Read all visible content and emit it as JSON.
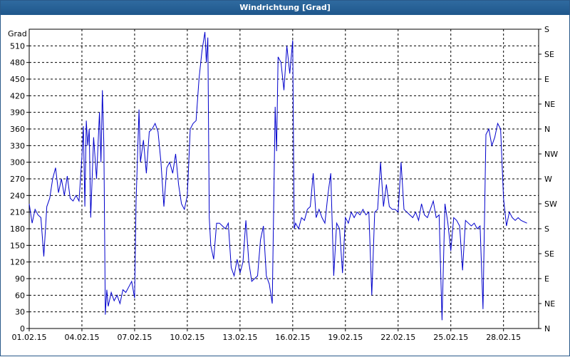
{
  "window": {
    "title": "Windrichtung [Grad]"
  },
  "chart_data": {
    "type": "line",
    "title": "Windrichtung [Grad]",
    "ylabel": "Grad",
    "ylim": [
      0,
      540
    ],
    "xlim": [
      "01.02.15",
      "02.03.15"
    ],
    "grid": true,
    "line_color": "#0000cc",
    "background": "#ffffff",
    "x_ticks": [
      "01.02.15",
      "04.02.15",
      "07.02.15",
      "10.02.15",
      "13.02.15",
      "16.02.15",
      "19.02.15",
      "22.02.15",
      "25.02.15",
      "28.02.15"
    ],
    "y_ticks": [
      0,
      30,
      60,
      90,
      120,
      150,
      180,
      210,
      240,
      270,
      300,
      330,
      360,
      390,
      420,
      450,
      480,
      510
    ],
    "right_axis": {
      "ticks": [
        0,
        45,
        90,
        135,
        180,
        225,
        270,
        315,
        360,
        405,
        450,
        495,
        540
      ],
      "labels": [
        "N",
        "NE",
        "E",
        "SE",
        "S",
        "SW",
        "W",
        "NW",
        "N",
        "NE",
        "E",
        "SE",
        "S"
      ]
    },
    "series": [
      {
        "points": [
          [
            "01.02.15 00:00",
            225
          ],
          [
            "01.02.15 04:00",
            190
          ],
          [
            "01.02.15 08:00",
            215
          ],
          [
            "01.02.15 12:00",
            205
          ],
          [
            "01.02.15 16:00",
            200
          ],
          [
            "01.02.15 20:00",
            130
          ],
          [
            "02.02.15 00:00",
            220
          ],
          [
            "02.02.15 04:00",
            235
          ],
          [
            "02.02.15 08:00",
            270
          ],
          [
            "02.02.15 12:00",
            290
          ],
          [
            "02.02.15 16:00",
            245
          ],
          [
            "02.02.15 20:00",
            270
          ],
          [
            "03.02.15 00:00",
            240
          ],
          [
            "03.02.15 04:00",
            275
          ],
          [
            "03.02.15 08:00",
            235
          ],
          [
            "03.02.15 12:00",
            230
          ],
          [
            "03.02.15 16:00",
            240
          ],
          [
            "03.02.15 20:00",
            230
          ],
          [
            "04.02.15 00:00",
            310
          ],
          [
            "04.02.15 02:00",
            365
          ],
          [
            "04.02.15 04:00",
            220
          ],
          [
            "04.02.15 06:00",
            375
          ],
          [
            "04.02.15 08:00",
            330
          ],
          [
            "04.02.15 10:00",
            360
          ],
          [
            "04.02.15 12:00",
            200
          ],
          [
            "04.02.15 16:00",
            345
          ],
          [
            "04.02.15 20:00",
            270
          ],
          [
            "05.02.15 00:00",
            390
          ],
          [
            "05.02.15 02:00",
            300
          ],
          [
            "05.02.15 04:00",
            430
          ],
          [
            "05.02.15 06:00",
            330
          ],
          [
            "05.02.15 08:00",
            25
          ],
          [
            "05.02.15 10:00",
            70
          ],
          [
            "05.02.15 12:00",
            40
          ],
          [
            "05.02.15 16:00",
            65
          ],
          [
            "05.02.15 20:00",
            50
          ],
          [
            "06.02.15 00:00",
            60
          ],
          [
            "06.02.15 04:00",
            45
          ],
          [
            "06.02.15 08:00",
            70
          ],
          [
            "06.02.15 12:00",
            65
          ],
          [
            "06.02.15 16:00",
            75
          ],
          [
            "06.02.15 20:00",
            85
          ],
          [
            "07.02.15 00:00",
            55
          ],
          [
            "07.02.15 02:00",
            230
          ],
          [
            "07.02.15 04:00",
            310
          ],
          [
            "07.02.15 06:00",
            395
          ],
          [
            "07.02.15 08:00",
            300
          ],
          [
            "07.02.15 12:00",
            340
          ],
          [
            "07.02.15 16:00",
            280
          ],
          [
            "07.02.15 20:00",
            355
          ],
          [
            "08.02.15 00:00",
            360
          ],
          [
            "08.02.15 04:00",
            370
          ],
          [
            "08.02.15 08:00",
            355
          ],
          [
            "08.02.15 12:00",
            300
          ],
          [
            "08.02.15 16:00",
            220
          ],
          [
            "08.02.15 20:00",
            290
          ],
          [
            "09.02.15 00:00",
            300
          ],
          [
            "09.02.15 04:00",
            280
          ],
          [
            "09.02.15 08:00",
            315
          ],
          [
            "09.02.15 12:00",
            260
          ],
          [
            "09.02.15 16:00",
            225
          ],
          [
            "09.02.15 20:00",
            215
          ],
          [
            "10.02.15 00:00",
            240
          ],
          [
            "10.02.15 04:00",
            360
          ],
          [
            "10.02.15 08:00",
            370
          ],
          [
            "10.02.15 12:00",
            375
          ],
          [
            "10.02.15 16:00",
            450
          ],
          [
            "10.02.15 20:00",
            500
          ],
          [
            "11.02.15 00:00",
            535
          ],
          [
            "11.02.15 02:00",
            480
          ],
          [
            "11.02.15 04:00",
            525
          ],
          [
            "11.02.15 06:00",
            200
          ],
          [
            "11.02.15 08:00",
            150
          ],
          [
            "11.02.15 12:00",
            125
          ],
          [
            "11.02.15 16:00",
            190
          ],
          [
            "11.02.15 20:00",
            190
          ],
          [
            "12.02.15 00:00",
            185
          ],
          [
            "12.02.15 04:00",
            180
          ],
          [
            "12.02.15 08:00",
            190
          ],
          [
            "12.02.15 12:00",
            110
          ],
          [
            "12.02.15 16:00",
            95
          ],
          [
            "12.02.15 20:00",
            125
          ],
          [
            "13.02.15 00:00",
            100
          ],
          [
            "13.02.15 04:00",
            120
          ],
          [
            "13.02.15 08:00",
            195
          ],
          [
            "13.02.15 12:00",
            120
          ],
          [
            "13.02.15 16:00",
            85
          ],
          [
            "13.02.15 20:00",
            90
          ],
          [
            "14.02.15 00:00",
            95
          ],
          [
            "14.02.15 04:00",
            160
          ],
          [
            "14.02.15 08:00",
            185
          ],
          [
            "14.02.15 12:00",
            95
          ],
          [
            "14.02.15 16:00",
            80
          ],
          [
            "14.02.15 20:00",
            45
          ],
          [
            "15.02.15 00:00",
            400
          ],
          [
            "15.02.15 02:00",
            320
          ],
          [
            "15.02.15 04:00",
            490
          ],
          [
            "15.02.15 08:00",
            480
          ],
          [
            "15.02.15 12:00",
            430
          ],
          [
            "15.02.15 16:00",
            510
          ],
          [
            "15.02.15 20:00",
            460
          ],
          [
            "16.02.15 00:00",
            520
          ],
          [
            "16.02.15 02:00",
            180
          ],
          [
            "16.02.15 04:00",
            190
          ],
          [
            "16.02.15 08:00",
            180
          ],
          [
            "16.02.15 12:00",
            200
          ],
          [
            "16.02.15 16:00",
            195
          ],
          [
            "16.02.15 20:00",
            215
          ],
          [
            "17.02.15 00:00",
            220
          ],
          [
            "17.02.15 04:00",
            280
          ],
          [
            "17.02.15 08:00",
            200
          ],
          [
            "17.02.15 12:00",
            215
          ],
          [
            "17.02.15 16:00",
            200
          ],
          [
            "17.02.15 20:00",
            190
          ],
          [
            "18.02.15 00:00",
            240
          ],
          [
            "18.02.15 04:00",
            280
          ],
          [
            "18.02.15 08:00",
            95
          ],
          [
            "18.02.15 12:00",
            190
          ],
          [
            "18.02.15 16:00",
            180
          ],
          [
            "18.02.15 20:00",
            100
          ],
          [
            "19.02.15 00:00",
            200
          ],
          [
            "19.02.15 04:00",
            190
          ],
          [
            "19.02.15 08:00",
            210
          ],
          [
            "19.02.15 12:00",
            200
          ],
          [
            "19.02.15 16:00",
            210
          ],
          [
            "19.02.15 20:00",
            205
          ],
          [
            "20.02.15 00:00",
            215
          ],
          [
            "20.02.15 04:00",
            205
          ],
          [
            "20.02.15 08:00",
            210
          ],
          [
            "20.02.15 12:00",
            60
          ],
          [
            "20.02.15 16:00",
            210
          ],
          [
            "20.02.15 20:00",
            215
          ],
          [
            "21.02.15 00:00",
            300
          ],
          [
            "21.02.15 04:00",
            220
          ],
          [
            "21.02.15 08:00",
            260
          ],
          [
            "21.02.15 12:00",
            220
          ],
          [
            "21.02.15 16:00",
            215
          ],
          [
            "21.02.15 20:00",
            215
          ],
          [
            "22.02.15 00:00",
            210
          ],
          [
            "22.02.15 04:00",
            300
          ],
          [
            "22.02.15 08:00",
            215
          ],
          [
            "22.02.15 12:00",
            210
          ],
          [
            "22.02.15 16:00",
            205
          ],
          [
            "22.02.15 20:00",
            200
          ],
          [
            "23.02.15 00:00",
            210
          ],
          [
            "23.02.15 04:00",
            195
          ],
          [
            "23.02.15 08:00",
            225
          ],
          [
            "23.02.15 12:00",
            205
          ],
          [
            "23.02.15 16:00",
            200
          ],
          [
            "23.02.15 20:00",
            215
          ],
          [
            "24.02.15 00:00",
            230
          ],
          [
            "24.02.15 04:00",
            200
          ],
          [
            "24.02.15 08:00",
            205
          ],
          [
            "24.02.15 12:00",
            15
          ],
          [
            "24.02.15 16:00",
            225
          ],
          [
            "24.02.15 20:00",
            190
          ],
          [
            "25.02.15 00:00",
            140
          ],
          [
            "25.02.15 04:00",
            200
          ],
          [
            "25.02.15 08:00",
            195
          ],
          [
            "25.02.15 12:00",
            185
          ],
          [
            "25.02.15 16:00",
            105
          ],
          [
            "25.02.15 20:00",
            195
          ],
          [
            "26.02.15 00:00",
            190
          ],
          [
            "26.02.15 04:00",
            185
          ],
          [
            "26.02.15 08:00",
            190
          ],
          [
            "26.02.15 12:00",
            180
          ],
          [
            "26.02.15 16:00",
            185
          ],
          [
            "26.02.15 20:00",
            35
          ],
          [
            "27.02.15 00:00",
            350
          ],
          [
            "27.02.15 04:00",
            360
          ],
          [
            "27.02.15 08:00",
            330
          ],
          [
            "27.02.15 12:00",
            345
          ],
          [
            "27.02.15 16:00",
            370
          ],
          [
            "27.02.15 20:00",
            360
          ],
          [
            "28.02.15 00:00",
            235
          ],
          [
            "28.02.15 04:00",
            185
          ],
          [
            "28.02.15 08:00",
            210
          ],
          [
            "28.02.15 12:00",
            200
          ],
          [
            "28.02.15 16:00",
            195
          ],
          [
            "28.02.15 20:00",
            200
          ],
          [
            "01.03.15 00:00",
            195
          ],
          [
            "01.03.15 08:00",
            190
          ]
        ]
      }
    ]
  }
}
